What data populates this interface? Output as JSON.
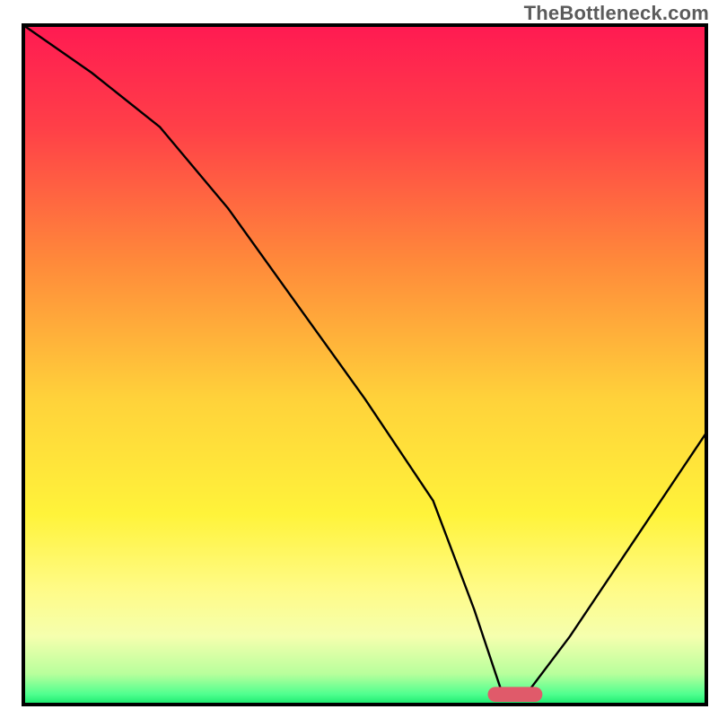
{
  "watermark": "TheBottleneck.com",
  "chart_data": {
    "type": "line",
    "title": "",
    "xlabel": "",
    "ylabel": "",
    "xlim": [
      0,
      100
    ],
    "ylim": [
      0,
      100
    ],
    "x": [
      0,
      10,
      20,
      30,
      40,
      50,
      60,
      66,
      70,
      74,
      80,
      90,
      100
    ],
    "values": [
      100,
      93,
      85,
      73,
      59,
      45,
      30,
      14,
      2,
      2,
      10,
      25,
      40
    ],
    "background_gradient": [
      {
        "stop": 0.0,
        "color": "#ff1a52"
      },
      {
        "stop": 0.15,
        "color": "#ff3f48"
      },
      {
        "stop": 0.35,
        "color": "#ff8a3a"
      },
      {
        "stop": 0.55,
        "color": "#ffd23a"
      },
      {
        "stop": 0.72,
        "color": "#fff33a"
      },
      {
        "stop": 0.83,
        "color": "#fffb87"
      },
      {
        "stop": 0.9,
        "color": "#f5ffae"
      },
      {
        "stop": 0.955,
        "color": "#b8ff9c"
      },
      {
        "stop": 0.985,
        "color": "#4fff8f"
      },
      {
        "stop": 1.0,
        "color": "#17e86b"
      }
    ],
    "marker": {
      "x": 72,
      "y": 1.5,
      "width": 8,
      "height": 2.2,
      "color": "#e05a6a"
    },
    "axis_color": "#000000",
    "line_color": "#000000"
  }
}
